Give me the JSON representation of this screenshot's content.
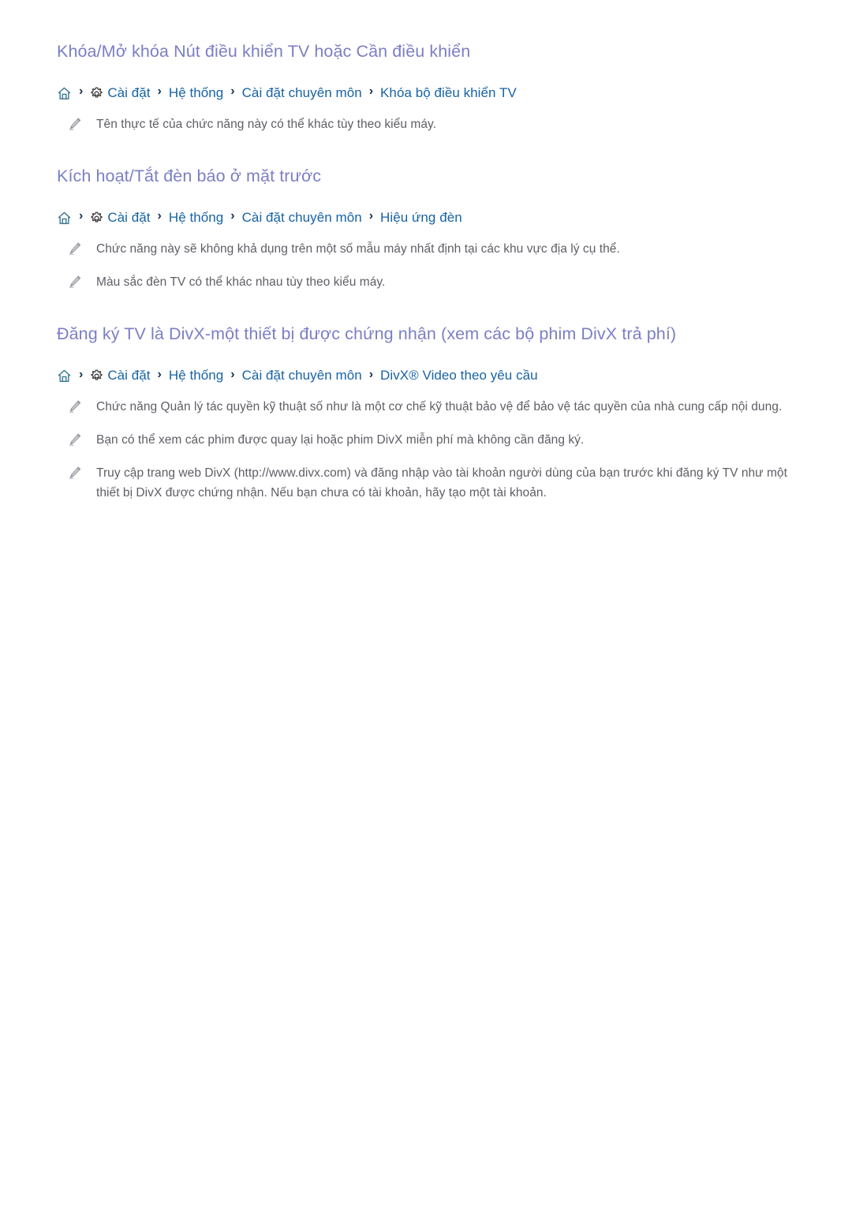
{
  "colors": {
    "heading": "#7b7fc4",
    "link": "#1763a6",
    "chevron": "#16304d",
    "body_text": "#5e5e66",
    "home_icon": "#3d7a94",
    "gear_icon": "#2b2b2b",
    "pencil_icon": "#9a9aa2",
    "background": "#ffffff"
  },
  "icons": {
    "home": "home-icon",
    "gear": "gear-icon",
    "pencil": "pencil-icon",
    "separator": "chevron-right-icon"
  },
  "separator": "›",
  "sections": [
    {
      "title": "Khóa/Mở khóa Nút điều khiển TV hoặc Cần điều khiển",
      "breadcrumb": {
        "home_label": "Home",
        "gear_label": "Settings",
        "items": [
          "Cài đặt",
          "Hệ thống",
          "Cài đặt chuyên môn",
          "Khóa bộ điều khiển TV"
        ]
      },
      "notes": [
        "Tên thực tế của chức năng này có thể khác tùy theo kiểu máy."
      ]
    },
    {
      "title": "Kích hoạt/Tắt đèn báo ở mặt trước",
      "breadcrumb": {
        "home_label": "Home",
        "gear_label": "Settings",
        "items": [
          "Cài đặt",
          "Hệ thống",
          "Cài đặt chuyên môn",
          "Hiệu ứng đèn"
        ]
      },
      "notes": [
        "Chức năng này sẽ không khả dụng trên một số mẫu máy nhất định tại các khu vực địa lý cụ thể.",
        "Màu sắc đèn TV có thể khác nhau tùy theo kiểu máy."
      ]
    },
    {
      "title": "Đăng ký TV là DivX-một thiết bị được chứng nhận (xem các bộ phim DivX trả phí)",
      "breadcrumb": {
        "home_label": "Home",
        "gear_label": "Settings",
        "items": [
          "Cài đặt",
          "Hệ thống",
          "Cài đặt chuyên môn",
          "DivX® Video theo yêu cầu"
        ]
      },
      "notes": [
        "Chức năng Quản lý tác quyền kỹ thuật số như là một cơ chế kỹ thuật bảo vệ để bảo vệ tác quyền của nhà cung cấp nội dung.",
        "Bạn có thể xem các phim được quay lại hoặc phim DivX miễn phí mà không cần đăng ký.",
        "Truy cập trang web DivX (http://www.divx.com) và đăng nhập vào tài khoản người dùng của bạn trước khi đăng ký TV như một thiết bị DivX được chứng nhận. Nếu bạn chưa có tài khoản, hãy tạo một tài khoản."
      ]
    }
  ]
}
